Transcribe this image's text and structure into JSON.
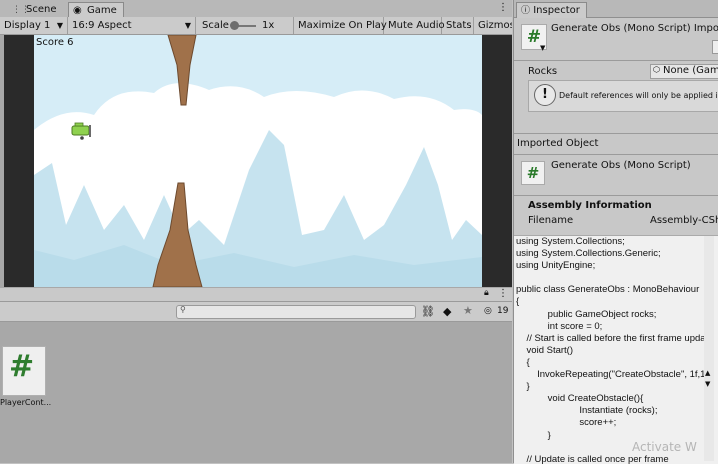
{
  "tabs": {
    "scene": "Scene",
    "game": "Game",
    "inspector": "Inspector"
  },
  "game_toolbar": {
    "display": "Display 1",
    "aspect": "16:9 Aspect",
    "scale_label": "Scale",
    "scale_value": "1x",
    "maximize": "Maximize On Play",
    "mute": "Mute Audio",
    "stats": "Stats",
    "gizmos": "Gizmos"
  },
  "game_view": {
    "score": "Score 6"
  },
  "project": {
    "search_placeholder": "",
    "hidden_count": "19",
    "asset_label": "PlayerCont..."
  },
  "inspector": {
    "title": "Generate Obs (Mono Script) Impo",
    "rocks_label": "Rocks",
    "rocks_value": "None (Game",
    "warning_text": "Default references will only be applied in",
    "imported_object_label": "Imported Object",
    "imported_object_name": "Generate Obs (Mono Script)",
    "assembly_header": "Assembly Information",
    "filename_label": "Filename",
    "filename_value": "Assembly-CSh",
    "watermark": "Activate W",
    "code": "using System.Collections;\nusing System.Collections.Generic;\nusing UnityEngine;\n\npublic class GenerateObs : MonoBehaviour\n{\n            public GameObject rocks;\n            int score = 0;\n    // Start is called before the first frame upda\n    void Start()\n    {\n        InvokeRepeating(\"CreateObstacle\", 1f,1.\n    }\n            void CreateObstacle(){\n                        Instantiate (rocks);\n                        score++;\n            }\n\n    // Update is called once per frame"
  },
  "colors": {
    "sky": "#d6edf7",
    "rock": "#a0714a",
    "plane": "#8fd14f",
    "code_bg": "#f0f0f0"
  }
}
